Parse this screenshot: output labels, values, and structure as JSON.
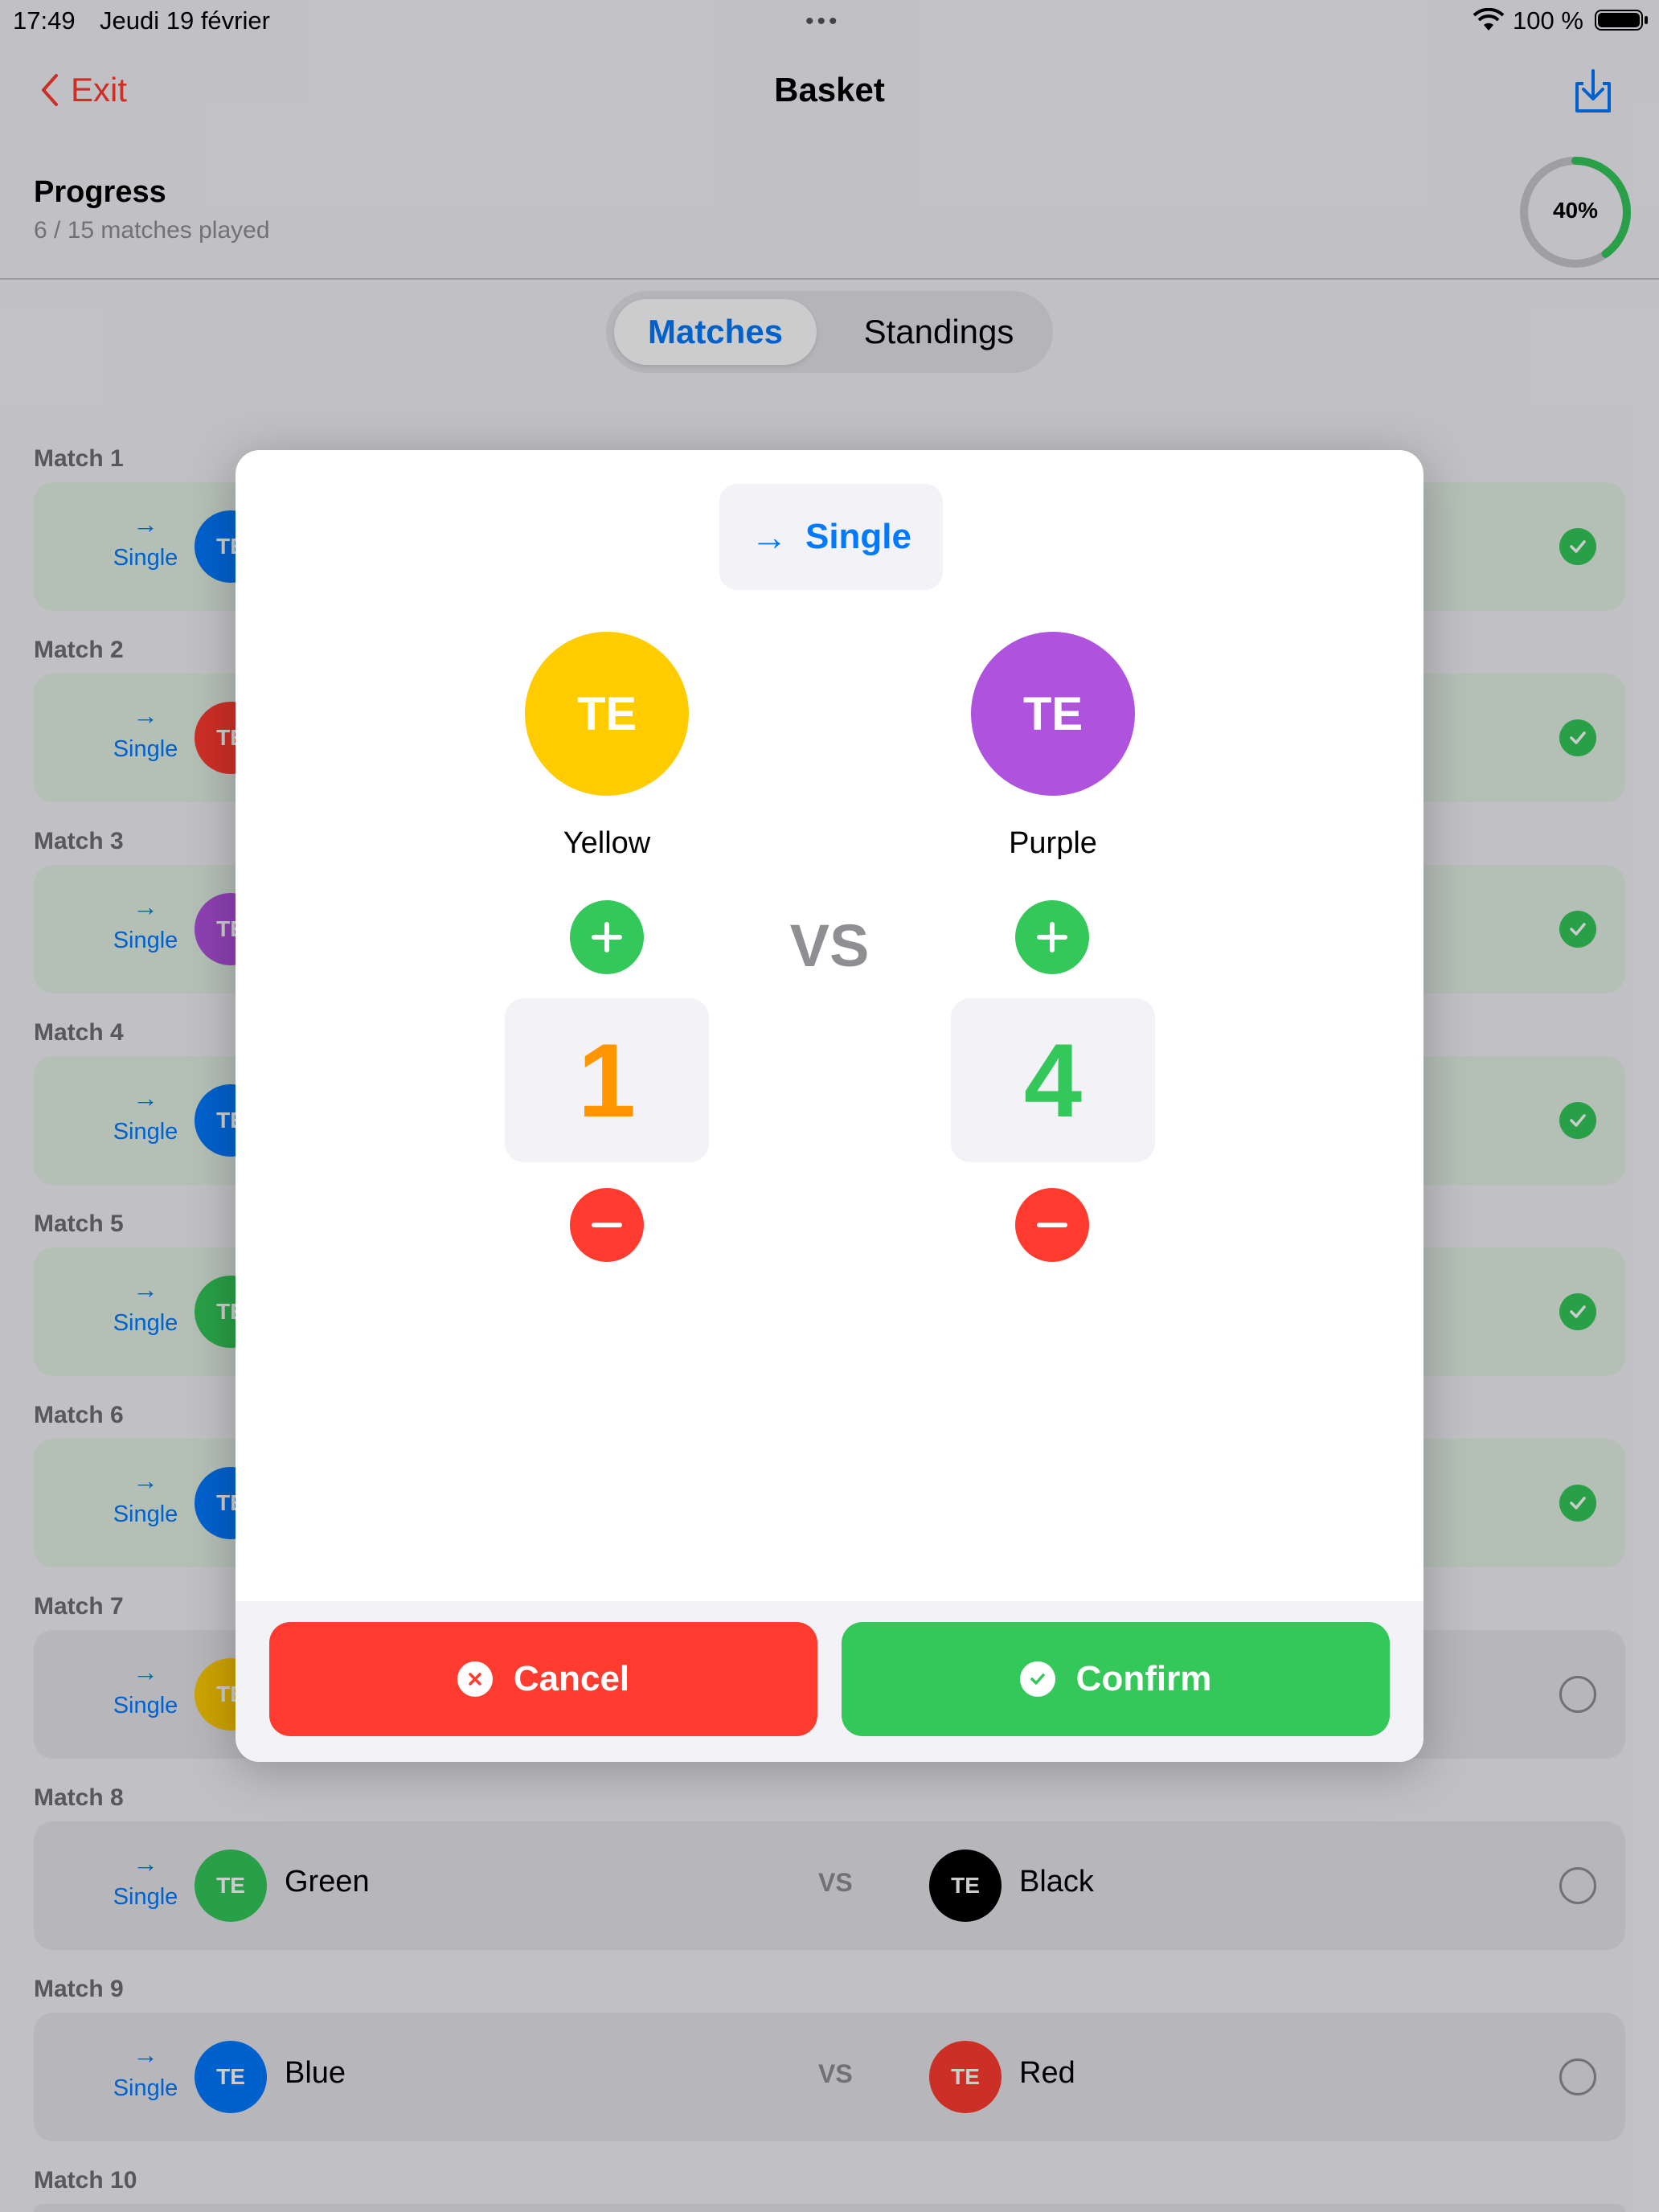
{
  "status_bar": {
    "time": "17:49",
    "date": "Jeudi 19 février",
    "battery": "100 %"
  },
  "nav": {
    "exit_label": "Exit",
    "title": "Basket"
  },
  "progress": {
    "title": "Progress",
    "subtitle": "6 / 15 matches played",
    "percent_label": "40%",
    "percent_value": 40
  },
  "tabs": {
    "matches": "Matches",
    "standings": "Standings"
  },
  "colors": {
    "green": "#34c759",
    "red": "#ff3b30",
    "blue": "#007aff",
    "orange": "#ff9500",
    "yellow": "#ffcc00",
    "purple": "#af52de",
    "team_red": "#ff3b30",
    "team_blue": "#007aff",
    "team_green": "#34c759",
    "black": "#000000"
  },
  "matches": [
    {
      "label": "Match 1",
      "mode": "Single",
      "home_initials": "TE",
      "played": true
    },
    {
      "label": "Match 2",
      "mode": "Single",
      "home_initials": "TE",
      "played": true
    },
    {
      "label": "Match 3",
      "mode": "Single",
      "home_initials": "TE",
      "played": true
    },
    {
      "label": "Match 4",
      "mode": "Single",
      "home_initials": "TE",
      "played": true
    },
    {
      "label": "Match 5",
      "mode": "Single",
      "home_initials": "TE",
      "played": true
    },
    {
      "label": "Match 6",
      "mode": "Single",
      "home_initials": "TE",
      "played": true
    },
    {
      "label": "Match 7",
      "mode": "Single",
      "home_initials": "TE",
      "played": false
    },
    {
      "label": "Match 8",
      "mode": "Single",
      "home_initials": "TE",
      "home": "Green",
      "vs": "VS",
      "away_initials": "TE",
      "away": "Black",
      "played": false
    },
    {
      "label": "Match 9",
      "mode": "Single",
      "home_initials": "TE",
      "home": "Blue",
      "vs": "VS",
      "away_initials": "TE",
      "away": "Red",
      "played": false
    },
    {
      "label": "Match 10"
    }
  ],
  "modal": {
    "mode": "Single",
    "home": {
      "initials": "TE",
      "name": "Yellow",
      "score": "1"
    },
    "away": {
      "initials": "TE",
      "name": "Purple",
      "score": "4"
    },
    "vs": "VS",
    "cancel_label": "Cancel",
    "confirm_label": "Confirm"
  }
}
